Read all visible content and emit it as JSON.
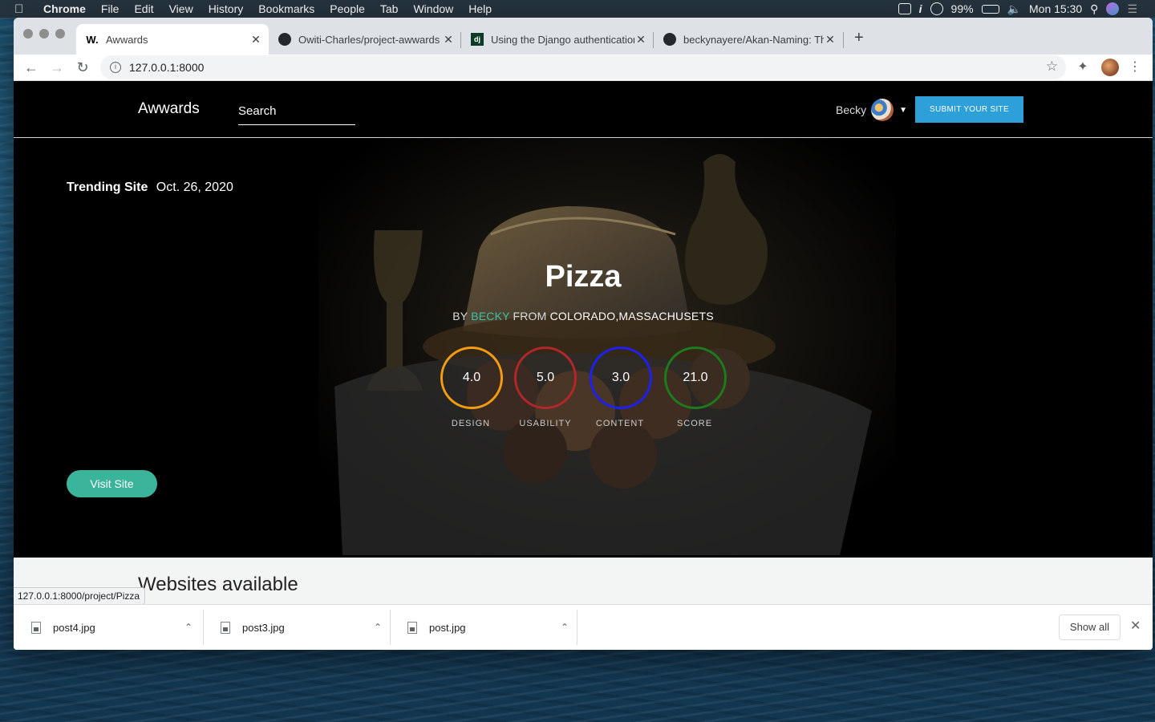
{
  "menubar": {
    "app": "Chrome",
    "items": [
      "File",
      "Edit",
      "View",
      "History",
      "Bookmarks",
      "People",
      "Tab",
      "Window",
      "Help"
    ],
    "battery": "99%",
    "clock": "Mon 15:30"
  },
  "browser": {
    "tabs": [
      {
        "favicon": "W.",
        "title": "Awwards"
      },
      {
        "favicon": "github-icon",
        "title": "Owiti-Charles/project-awwards"
      },
      {
        "favicon": "dj",
        "title": "Using the Django authentication"
      },
      {
        "favicon": "github-icon",
        "title": "beckynayere/Akan-Naming: Th"
      }
    ],
    "url": "127.0.0.1:8000"
  },
  "site": {
    "brand": "Awwards",
    "search_placeholder": "Search",
    "user_name": "Becky",
    "submit_label": "SUBMIT YOUR SITE"
  },
  "hero": {
    "trending_label": "Trending Site",
    "date": "Oct. 26, 2020",
    "title": "Pizza",
    "by": "BY",
    "author": "BECKY",
    "from": "FROM",
    "location": "COLORADO,MASSACHUSETS",
    "visit_label": "Visit Site",
    "scores": [
      {
        "value": "4.0",
        "label": "DESIGN",
        "color": "#f39c12"
      },
      {
        "value": "5.0",
        "label": "USABILITY",
        "color": "#b3262a"
      },
      {
        "value": "3.0",
        "label": "CONTENT",
        "color": "#1f1ff0"
      },
      {
        "value": "21.0",
        "label": "SCORE",
        "color": "#1d7a1d"
      }
    ]
  },
  "section": {
    "title": "Websites available"
  },
  "status_url": "127.0.0.1:8000/project/Pizza",
  "downloads": {
    "items": [
      "post4.jpg",
      "post3.jpg",
      "post.jpg"
    ],
    "show_all": "Show all"
  }
}
